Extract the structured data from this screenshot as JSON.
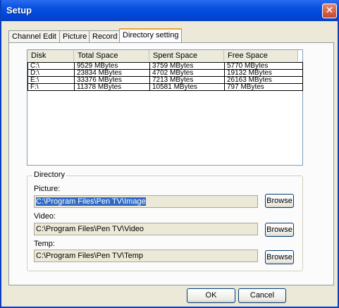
{
  "window": {
    "title": "Setup"
  },
  "tabs": [
    "Channel Edit",
    "Picture",
    "Record",
    "Directory setting"
  ],
  "disk_list": {
    "headers": [
      "Disk",
      "Total Space",
      "Spent Space",
      "Free Space"
    ],
    "rows": [
      [
        "C:\\",
        "9529  MBytes",
        "3759  MBytes",
        "5770  MBytes"
      ],
      [
        "D:\\",
        "23834  MBytes",
        "4702  MBytes",
        "19132  MBytes"
      ],
      [
        "E:\\",
        "33376  MBytes",
        "7213  MBytes",
        "26163  MBytes"
      ],
      [
        "F:\\",
        "11378  MBytes",
        "10581  MBytes",
        "797  MBytes"
      ]
    ]
  },
  "directory": {
    "group_label": "Directory",
    "picture_label": "Picture:",
    "picture_path": "C:\\Program Files\\Pen TV\\Image",
    "video_label": "Video:",
    "video_path": "C:\\Program Files\\Pen TV\\Video",
    "temp_label": "Temp:",
    "temp_path": "C:\\Program Files\\Pen TV\\Temp",
    "browse_label": "Browse"
  },
  "buttons": {
    "ok": "OK",
    "cancel": "Cancel"
  },
  "colors": {
    "titlebar": "#0054e3",
    "close": "#d45a3c",
    "selection": "#316ac5",
    "active_tab_accent": "#e8a73b"
  },
  "icons": {
    "close": "close-icon"
  }
}
